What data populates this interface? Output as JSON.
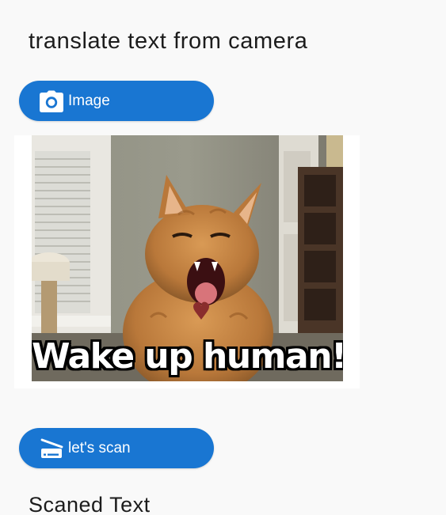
{
  "header": {
    "title": "translate text from camera"
  },
  "image_button": {
    "label": "Image",
    "icon": "camera-icon"
  },
  "preview": {
    "caption": "Wake up human!",
    "subject": "yawning orange cat meme"
  },
  "scan_button": {
    "label": "let's scan",
    "icon": "scanner-icon"
  },
  "result": {
    "heading": "Scaned Text"
  },
  "colors": {
    "accent": "#1976d2",
    "background": "#f9f9f9",
    "text": "#1c1c1c"
  }
}
